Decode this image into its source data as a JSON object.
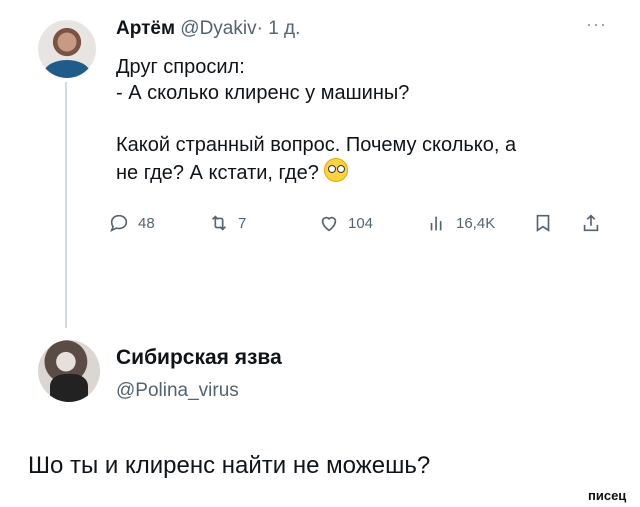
{
  "tweet": {
    "author": "Артём",
    "handle": "@Dyakiv",
    "separator": "·",
    "time": "1 д.",
    "more_label": "···",
    "lines": [
      "Друг спросил:",
      "- А сколько клиренс у машины?"
    ],
    "lines2": [
      "Какой странный вопрос. Почему сколько, а",
      "не где? А кстати, где?"
    ],
    "emoji": "face-with-rolling-eyes",
    "stats": {
      "replies": "48",
      "retweets": "7",
      "likes": "104",
      "views": "16,4K"
    },
    "icons": {
      "reply": "reply-icon",
      "retweet": "retweet-icon",
      "like": "heart-icon",
      "views": "views-chart-icon",
      "bookmark": "bookmark-icon",
      "share": "share-icon"
    }
  },
  "reply": {
    "author": "Сибирская язва",
    "handle": "@Polina_virus",
    "text": "Шо ты и клиренс найти не можешь?"
  },
  "watermark": "писец"
}
